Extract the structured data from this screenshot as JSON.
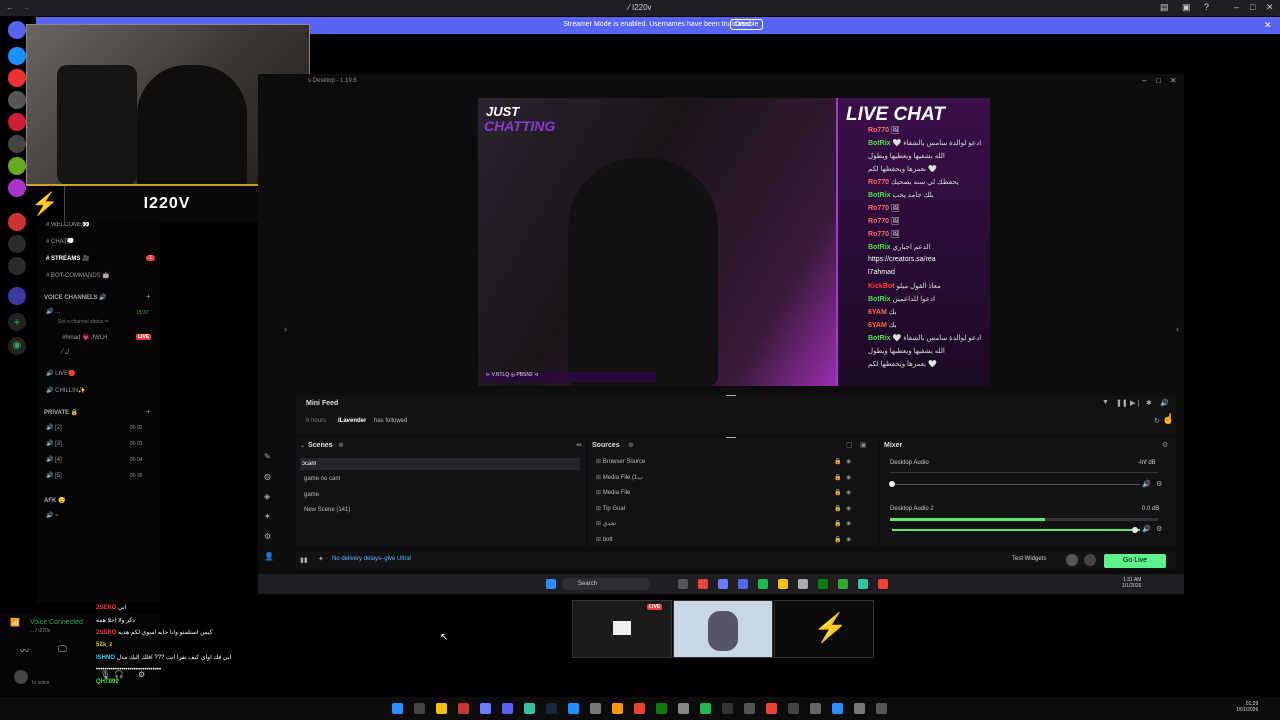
{
  "titlebar": {
    "title": "⁄ I220v"
  },
  "streamer_banner": {
    "message": "Streamer Mode is enabled. Usernames have been truncated.",
    "button": "Disable"
  },
  "overlay": {
    "name": "I220V"
  },
  "sidebar": {
    "channels": [
      "WELCOME👀",
      "CHAT💭",
      "STREAMS 🎥",
      "BOT-COMMANDS 🤖"
    ],
    "streams_badge": "1",
    "voice_header": "VOICE CHANNELS 🔊",
    "voice_timer": "15:37",
    "voice_status": "Set a channel status ✏",
    "voice_user1": "#hmad",
    "voice_user2": "💗 JWLH",
    "live_label": "LIVE",
    "voice_user3": "⁄ ل",
    "live_channel": "LIVE🔴",
    "chillin_channel": "CHILLIN✨",
    "private_header": "PRIVATE 🔒",
    "private_channels": [
      {
        "name": "[2]",
        "a": "00",
        "b": "02"
      },
      {
        "name": "[3]",
        "a": "00",
        "b": "03"
      },
      {
        "name": "[4]",
        "a": "00",
        "b": "04"
      },
      {
        "name": "[5]",
        "a": "00",
        "b": "05"
      }
    ],
    "afk_header": "AFK 😴",
    "voice_connected": "Voice Connected",
    "voice_connected_sub": "... / i220v",
    "user_status": "In voice"
  },
  "studio": {
    "title": "s Desktop - 1.19.6",
    "preview": {
      "just": "JUST",
      "chatting": "CHATTING",
      "banner": "⊳ V.NTLQ ◎ PBSN2 ⊲",
      "chat_header": "LIVE CHAT",
      "messages": [
        {
          "user": "Ro770",
          "text": "🖼",
          "color": "#ff6a6a"
        },
        {
          "user": "BotRix",
          "text": "🤍 ادعو لوالدة سامس بالشفاء",
          "color": "#4be34b"
        },
        {
          "user": "",
          "text": "الله يشفيها ويعطيها ويطول",
          "color": "#ddd"
        },
        {
          "user": "",
          "text": "بعمرها ويحفظها لكم 🤍",
          "color": "#ddd"
        },
        {
          "user": "Ro770",
          "text": "يحفظك لي سنه بصحيك",
          "color": "#ff6a6a"
        },
        {
          "user": "BotRix",
          "text": "بلك جامد يحب",
          "color": "#4be34b"
        },
        {
          "user": "Ro770",
          "text": "🖼",
          "color": "#ff6a6a"
        },
        {
          "user": "Ro770",
          "text": "🖼",
          "color": "#ff6a6a"
        },
        {
          "user": "Ro770",
          "text": "🖼",
          "color": "#ff6a6a"
        },
        {
          "user": "BotRix",
          "text": "الدعم اجباري",
          "color": "#4be34b"
        },
        {
          "user": "",
          "text": "https://creators.sa/rea",
          "color": "#fff"
        },
        {
          "user": "",
          "text": "l7ahmad",
          "color": "#fff"
        },
        {
          "user": "KickBot",
          "text": "معاذ القول ميلو",
          "color": "#ff3b3b"
        },
        {
          "user": "BotRix",
          "text": "ادعوا للداعمين",
          "color": "#4be34b"
        },
        {
          "user": "6YAM",
          "text": "بك",
          "color": "#ff6a3a"
        },
        {
          "user": "6YAM",
          "text": "بك",
          "color": "#ff6a3a"
        },
        {
          "user": "BotRix",
          "text": "🤍 ادعو لوالدة سامس بالشفاء",
          "color": "#4be34b"
        },
        {
          "user": "",
          "text": "الله يشفيها ويعطيها ويطول",
          "color": "#ddd"
        },
        {
          "user": "",
          "text": "بعمرها ويحفظها لكم 🤍",
          "color": "#ddd"
        }
      ]
    },
    "minifeed": {
      "title": "Mini Feed",
      "time": "6 hours",
      "user": "ILavender",
      "event": "has followed"
    },
    "scenes": {
      "title": "Scenes",
      "items": [
        "ɔcam",
        "game no cam",
        "game",
        "New Scene (141)"
      ]
    },
    "sources": {
      "title": "Sources",
      "items": [
        "Browser Source",
        "Media File (1ب",
        "Media File",
        "Tip Goal",
        "تحدي",
        "bott"
      ]
    },
    "mixer": {
      "title": "Mixer",
      "channels": [
        {
          "name": "Desktop Audio",
          "level": "-Inf dB",
          "meter": 0.0,
          "volume": 0.0
        },
        {
          "name": "Desktop Audio 2",
          "level": "0.0 dB",
          "meter": 0.58,
          "volume": 0.98
        }
      ]
    },
    "bottom": {
      "ultra": "No delivery delays–give Ultra!",
      "test_widgets": "Test Widgets",
      "go_live": "Go Live"
    },
    "inner_taskbar": {
      "search": "Search",
      "time": "1:31 AM",
      "date": "1/1/2026"
    }
  },
  "overlay_chat": [
    {
      "user": "2SERO",
      "text": "ابي",
      "color": "#ff3b3b"
    },
    {
      "user": "",
      "text": "ذكر ولا احلا همه",
      "color": "#fff"
    },
    {
      "user": "2SERO",
      "text": "كيس استلمتو وانا جايه اسوي لكم هديه",
      "color": "#ff3b3b"
    },
    {
      "user": "52a_z",
      "text": "",
      "color": "#e7c500"
    },
    {
      "user": "ISHNO",
      "text": "ابي فك اواي كيف نفرا انت ??? افلك اليك مدل",
      "color": "#3bd5ff"
    },
    {
      "user": "",
      "text": "•••••••••••••••••••••••••••••••",
      "color": "#fff"
    },
    {
      "user": "QHT899",
      "text": "",
      "color": "#4be34b"
    }
  ],
  "thumb_live": "LIVE",
  "taskbar": {
    "time": "01:29",
    "date": "1/01/2026"
  }
}
